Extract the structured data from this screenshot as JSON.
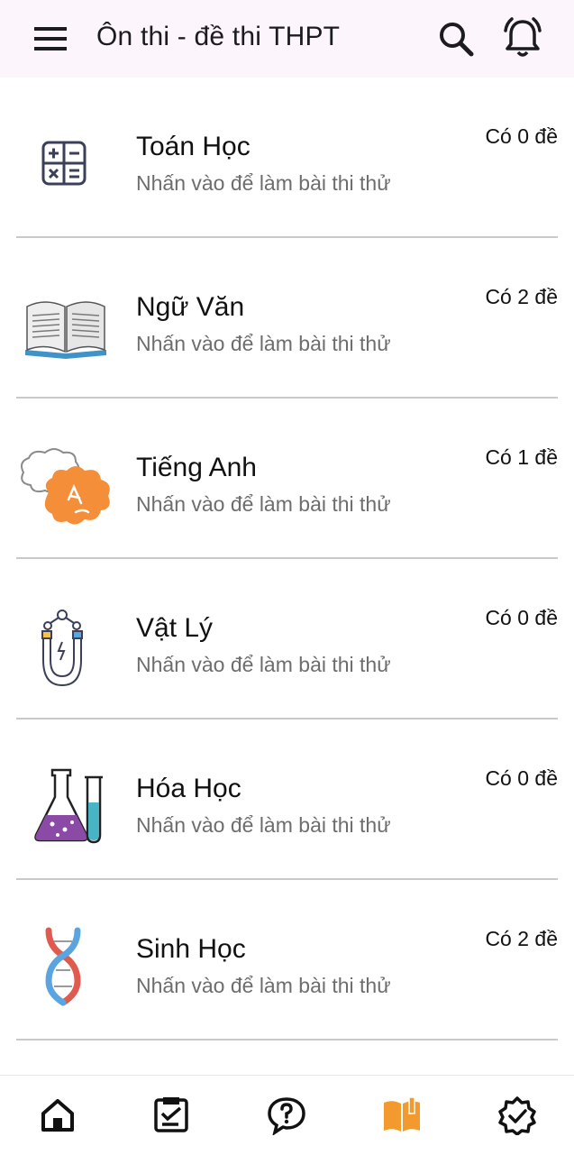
{
  "appbar": {
    "title": "Ôn thi - đề thi THPT",
    "menu_icon": "menu-icon",
    "search_icon": "search-icon",
    "bell_icon": "notification-bell-icon"
  },
  "subjects": [
    {
      "name": "Toán Học",
      "subtitle": "Nhấn vào để làm bài thi thử",
      "count": "Có 0 đề",
      "icon": "calculator-icon"
    },
    {
      "name": "Ngữ Văn",
      "subtitle": "Nhấn vào để làm bài thi thử",
      "count": "Có 2 đề",
      "icon": "open-book-icon"
    },
    {
      "name": "Tiếng Anh",
      "subtitle": "Nhấn vào để làm bài thi thử",
      "count": "Có 1 đề",
      "icon": "speech-bubbles-icon"
    },
    {
      "name": "Vật Lý",
      "subtitle": "Nhấn vào để làm bài thi thử",
      "count": "Có 0 đề",
      "icon": "magnet-icon"
    },
    {
      "name": "Hóa Học",
      "subtitle": "Nhấn vào để làm bài thi thử",
      "count": "Có 0 đề",
      "icon": "flask-icon"
    },
    {
      "name": "Sinh Học",
      "subtitle": "Nhấn vào để làm bài thi thử",
      "count": "Có 2 đề",
      "icon": "dna-icon"
    }
  ],
  "bottom_nav": {
    "items": [
      {
        "icon": "home-icon",
        "active": false
      },
      {
        "icon": "clipboard-icon",
        "active": false
      },
      {
        "icon": "question-bubble-icon",
        "active": false
      },
      {
        "icon": "book-icon",
        "active": true
      },
      {
        "icon": "verified-badge-icon",
        "active": false
      }
    ],
    "active_color": "#f29a2e",
    "inactive_color": "#111111"
  },
  "colors": {
    "appbar_bg": "#fcf5fb",
    "accent": "#f29a2e"
  }
}
